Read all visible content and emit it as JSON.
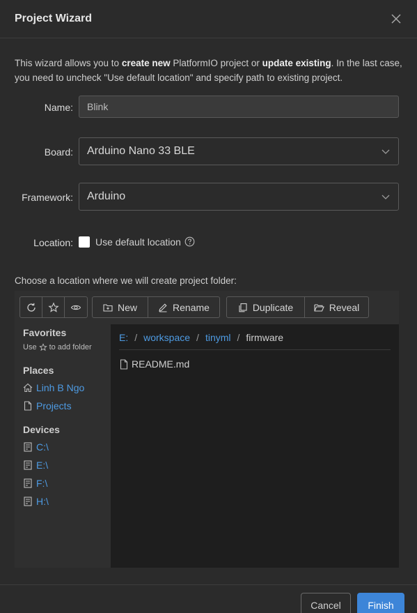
{
  "dialog": {
    "title": "Project Wizard",
    "close_icon": "close-icon"
  },
  "intro": {
    "part1": "This wizard allows you to ",
    "bold1": "create new",
    "part2": " PlatformIO project or ",
    "bold2": "update existing",
    "part3": ". In the last case, you need to uncheck \"Use default location\" and specify path to existing project."
  },
  "form": {
    "name_label": "Name:",
    "name_value": "Blink",
    "board_label": "Board:",
    "board_value": "Arduino Nano 33 BLE",
    "framework_label": "Framework:",
    "framework_value": "Arduino",
    "location_label": "Location:",
    "use_default_location_label": "Use default location",
    "use_default_location_checked": false
  },
  "choose_text": "Choose a location where we will create project folder:",
  "toolbar": {
    "refresh_icon": "refresh-icon",
    "favorite_icon": "star-icon",
    "show_hidden_icon": "eye-icon",
    "new_label": "New",
    "rename_label": "Rename",
    "duplicate_label": "Duplicate",
    "reveal_label": "Reveal"
  },
  "sidebar": {
    "favorites_heading": "Favorites",
    "favorites_hint_pre": "Use",
    "favorites_hint_post": "to add folder",
    "places_heading": "Places",
    "places": [
      {
        "label": "Linh B Ngo",
        "icon": "home-icon"
      },
      {
        "label": "Projects",
        "icon": "file-icon"
      }
    ],
    "devices_heading": "Devices",
    "devices": [
      {
        "label": "C:\\",
        "icon": "drive-icon"
      },
      {
        "label": "E:\\",
        "icon": "drive-icon"
      },
      {
        "label": "F:\\",
        "icon": "drive-icon"
      },
      {
        "label": "H:\\",
        "icon": "drive-icon"
      }
    ]
  },
  "breadcrumb": {
    "items": [
      "E:",
      "workspace",
      "tinyml"
    ],
    "separator": "/",
    "current": "firmware"
  },
  "files": [
    {
      "name": "README.md",
      "icon": "file-icon"
    }
  ],
  "footer": {
    "cancel_label": "Cancel",
    "finish_label": "Finish"
  },
  "colors": {
    "background": "#2b2b2b",
    "link": "#4e9be3",
    "primary_button": "#3d85d8"
  }
}
